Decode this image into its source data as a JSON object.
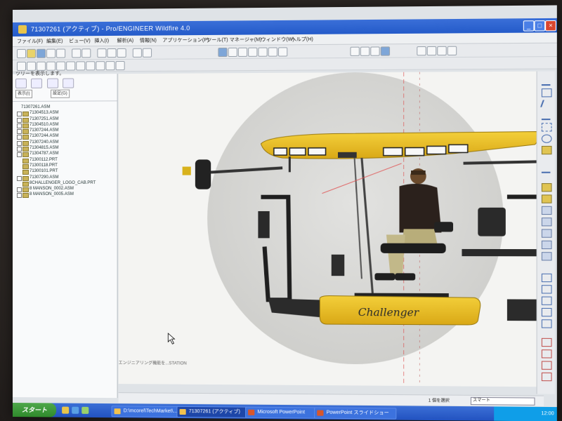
{
  "window": {
    "title": "71307261 (アクティブ) - Pro/ENGINEER Wildfire 4.0",
    "min_label": "_",
    "max_label": "□",
    "close_label": "×"
  },
  "menu": [
    "ファイル(F)",
    "編集(E)",
    "ビュー(V)",
    "挿入(I)",
    "解析(A)",
    "情報(N)",
    "アプリケーション(P)",
    "ツール(T)",
    "マネージャ(M)",
    "ウィンドウ(W)",
    "ヘルプ(H)"
  ],
  "left_panel": {
    "hint": "ツリーを表示します。",
    "filter_1": "表示(I)",
    "filter_2": "設定(G)",
    "tree": [
      {
        "label": "71307261.ASM",
        "root": true
      },
      {
        "label": "71304513.ASM"
      },
      {
        "label": "71307251.ASM"
      },
      {
        "label": "71304510.ASM"
      },
      {
        "label": "71307244.ASM"
      },
      {
        "label": "71307244.ASM"
      },
      {
        "label": "71307240.ASM"
      },
      {
        "label": "71304815.ASM"
      },
      {
        "label": "71304787.ASM"
      },
      {
        "label": "71300112.PRT"
      },
      {
        "label": "71300118.PRT"
      },
      {
        "label": "71300101.PRT"
      },
      {
        "label": "71307290.ASM"
      },
      {
        "label": "8CHALLENGER_LOGO_CAB.PRT"
      },
      {
        "label": "8 MANSON_0002.ASM"
      },
      {
        "label": "8 MANSON_0005.ASM"
      }
    ]
  },
  "viewport": {
    "status_text": "エンジニアリング機能を...STATION",
    "brand_on_model": "Challenger"
  },
  "bottom": {
    "selection_label": "1 個を選択",
    "filter_value": "スマート"
  },
  "taskbar": {
    "start_label": "スタート",
    "tasks": [
      {
        "label": "D:\\mcorel\\TechMarket\\..."
      },
      {
        "label": "71307261 (アクティブ)",
        "active": true
      },
      {
        "label": "Microsoft PowerPoint"
      },
      {
        "label": "PowerPoint スライドショー"
      }
    ],
    "tray_time": "12:00"
  }
}
